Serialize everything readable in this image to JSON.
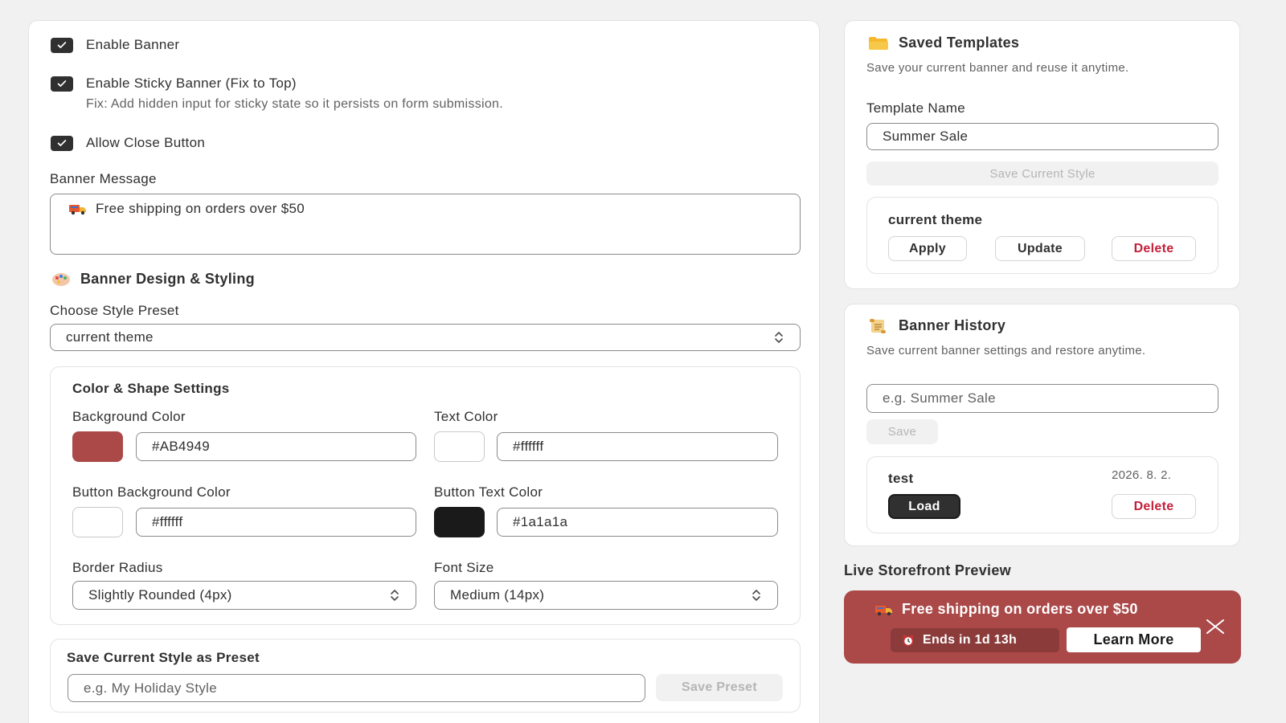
{
  "settings": {
    "enable_banner": {
      "label": "Enable Banner",
      "checked": true
    },
    "sticky_banner": {
      "label": "Enable Sticky Banner (Fix to Top)",
      "checked": true,
      "help": "Fix: Add hidden input for sticky state so it persists on form submission."
    },
    "close_button": {
      "label": "Allow Close Button",
      "checked": true
    },
    "message": {
      "label": "Banner Message",
      "icon": "truck-emoji",
      "value": "Free shipping on orders over $50"
    }
  },
  "design": {
    "heading": "Banner Design & Styling",
    "heading_icon": "palette-emoji",
    "preset_label": "Choose Style Preset",
    "preset_value": "current theme",
    "color_shape": {
      "title": "Color & Shape Settings",
      "background_color": {
        "label": "Background Color",
        "value": "#AB4949",
        "swatch": "#AB4949"
      },
      "text_color": {
        "label": "Text Color",
        "value": "#ffffff",
        "swatch": "#ffffff"
      },
      "button_bg_color": {
        "label": "Button Background Color",
        "value": "#ffffff",
        "swatch": "#ffffff"
      },
      "button_text_color": {
        "label": "Button Text Color",
        "value": "#1a1a1a",
        "swatch": "#1a1a1a"
      },
      "border_radius": {
        "label": "Border Radius",
        "value": "Slightly Rounded (4px)"
      },
      "font_size": {
        "label": "Font Size",
        "value": "Medium (14px)"
      }
    },
    "save_preset": {
      "title": "Save Current Style as Preset",
      "placeholder": "e.g. My Holiday Style",
      "button": "Save Preset"
    }
  },
  "templates": {
    "title": "Saved Templates",
    "icon": "folder-emoji",
    "description": "Save your current banner and reuse it anytime.",
    "name_label": "Template Name",
    "name_value": "Summer Sale",
    "save_button": "Save Current Style",
    "items": [
      {
        "name": "current theme",
        "apply": "Apply",
        "update": "Update",
        "delete": "Delete"
      }
    ]
  },
  "history": {
    "title": "Banner History",
    "icon": "scroll-emoji",
    "description": "Save current banner settings and restore anytime.",
    "placeholder": "e.g. Summer Sale",
    "save_button": "Save",
    "items": [
      {
        "name": "test",
        "date": "2026. 8. 2.",
        "load": "Load",
        "delete": "Delete"
      }
    ]
  },
  "preview": {
    "title": "Live Storefront Preview",
    "message": "Free shipping on orders over $50",
    "countdown": "Ends in 1d 13h",
    "cta": "Learn More",
    "background": "#AB4949",
    "text_color": "#ffffff"
  }
}
